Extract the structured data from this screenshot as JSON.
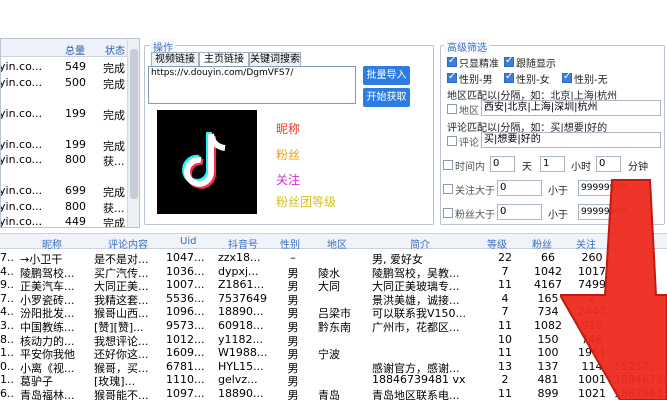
{
  "top_list": {
    "columns": [
      "总量",
      "状态"
    ],
    "rows": [
      {
        "name": "yin.co...",
        "total": "549",
        "status": "完成"
      },
      {
        "name": "yin.co...",
        "total": "500",
        "status": "完成"
      },
      {
        "name": "",
        "total": "",
        "status": ""
      },
      {
        "name": "yin.co...",
        "total": "199",
        "status": "完成"
      },
      {
        "name": "",
        "total": "",
        "status": ""
      },
      {
        "name": "yin.co...",
        "total": "199",
        "status": "完成"
      },
      {
        "name": "yin.co...",
        "total": "800",
        "status": "获..."
      },
      {
        "name": "",
        "total": "",
        "status": ""
      },
      {
        "name": "yin.co...",
        "total": "699",
        "status": "完成"
      },
      {
        "name": "yin.co...",
        "total": "800",
        "status": "获..."
      },
      {
        "name": "yin.co...",
        "total": "449",
        "status": "完成"
      }
    ]
  },
  "operation": {
    "title": "操作",
    "tabs": [
      "视频链接",
      "主页链接",
      "关键词搜索"
    ],
    "url_value": "https://v.douyin.com/DgmVFS7/",
    "import_button": "批量导入",
    "start_button": "开始获取"
  },
  "preview": {
    "nickname": "昵称",
    "fans": "粉丝",
    "follow": "关注",
    "fans_group": "粉丝团等级"
  },
  "colors": {
    "accent": "#2d7de0",
    "nickname": "#e8381f",
    "fans": "#e8a21a",
    "follow": "#cc33cc",
    "fans_group": "#d6c21a"
  },
  "filters": {
    "title": "高级筛选",
    "only_precise": "只显精准",
    "follow_show": "跟随显示",
    "gender_male": "性别-男",
    "gender_female": "性别-女",
    "gender_none": "性别-无",
    "region_hint": "地区匹配以|分隔，如：北京|上海|杭州",
    "region_label": "地区",
    "region_value": "西安|北京|上海|深圳|杭州",
    "comment_hint": "评论匹配以|分隔，如：买|想要|好的",
    "comment_label": "评论",
    "comment_value": "买|想要|好的",
    "time_label": "时间内",
    "time_day": "0",
    "time_day_unit": "天",
    "time_hour": "1",
    "time_hour_unit": "小时",
    "time_min": "0",
    "time_min_unit": "分钟",
    "follow_gt_label": "关注大于",
    "follow_gt_min": "0",
    "follow_lt_label": "小于",
    "follow_lt_max": "99999999",
    "fans_gt_label": "粉丝大于",
    "fans_gt_min": "0",
    "fans_lt_label": "小于",
    "fans_lt_max": "99999999"
  },
  "grid": {
    "columns": [
      "昵称",
      "评论内容",
      "Uid",
      "抖音号",
      "性别",
      "地区",
      "简介",
      "等级",
      "粉丝",
      "关注"
    ],
    "rows": [
      {
        "c0": "7...",
        "nick": "→小卫干",
        "comment": "是不是对...",
        "uid": "1047...",
        "dy": "zzx18...",
        "gender": "–",
        "region": "",
        "bio": "男, 爱好女",
        "level": "22",
        "fans": "66",
        "follow": "260"
      },
      {
        "c0": "4...",
        "nick": "陵鹏驾校...",
        "comment": "买广汽传...",
        "uid": "1036...",
        "dy": "dypxj...",
        "gender": "男",
        "region": "陵水",
        "bio": "陵鹏驾校，吴教...",
        "level": "7",
        "fans": "1042",
        "follow": "1017"
      },
      {
        "c0": "9...",
        "nick": "正美汽车...",
        "comment": "大同正美...",
        "uid": "1007...",
        "dy": "Z1861...",
        "gender": "男",
        "region": "大同",
        "bio": "大同正美玻璃专...",
        "level": "11",
        "fans": "4167",
        "follow": "7499"
      },
      {
        "c0": "7...",
        "nick": "小罗瓷砖...",
        "comment": "我精这套...",
        "uid": "5536...",
        "dy": "7537649",
        "gender": "男",
        "region": "",
        "bio": "景洪美雄，诚接...",
        "level": "4",
        "fans": "165",
        "follow": "2"
      },
      {
        "c0": "4...",
        "nick": "汾阳批发...",
        "comment": "猴哥山西...",
        "uid": "1096...",
        "dy": "18890...",
        "gender": "男",
        "region": "吕梁市",
        "bio": "可以联系我V150...",
        "level": "7",
        "fans": "734",
        "follow": "2447"
      },
      {
        "c0": "3...",
        "nick": "中国教练...",
        "comment": "[赞][赞]...",
        "uid": "9573...",
        "dy": "60918...",
        "gender": "男",
        "region": "黔东南",
        "bio": "广州市，花都区...",
        "level": "11",
        "fans": "1082",
        "follow": "918"
      },
      {
        "c0": "8...",
        "nick": "核动力的...",
        "comment": "我想评论...",
        "uid": "1012...",
        "dy": "y1182...",
        "gender": "男",
        "region": "",
        "bio": "",
        "level": "10",
        "fans": "150",
        "follow": "748"
      },
      {
        "c0": "1...",
        "nick": "平安你我他",
        "comment": "还好你这...",
        "uid": "1609...",
        "dy": "W1988...",
        "gender": "男",
        "region": "宁波",
        "bio": "",
        "level": "11",
        "fans": "100",
        "follow": "1961"
      },
      {
        "c0": "0...",
        "nick": "小离《视...",
        "comment": "猴哥，买...",
        "uid": "6781...",
        "dy": "HYL15...",
        "gender": "男",
        "region": "",
        "bio": "感谢官方，感谢...",
        "level": "13",
        "fans": "137",
        "follow": "114"
      },
      {
        "c0": "1...",
        "nick": "葛驴子",
        "comment": "[玫瑰]...",
        "uid": "1110...",
        "dy": "gelvz...",
        "gender": "男",
        "region": "",
        "bio": "18846739481   vx",
        "level": "2",
        "fans": "481",
        "follow": "1001"
      },
      {
        "c0": "6...",
        "nick": "青岛福林...",
        "comment": "猴哥能不...",
        "uid": "1097...",
        "dy": "18890...",
        "gender": "男",
        "region": "青岛",
        "bio": "青岛地区联系电...",
        "level": "11",
        "fans": "899",
        "follow": "1021"
      }
    ],
    "extra_right": [
      "",
      "",
      "",
      "",
      "",
      "",
      "",
      "",
      "15217...",
      "18846739481",
      "18678613..."
    ]
  }
}
